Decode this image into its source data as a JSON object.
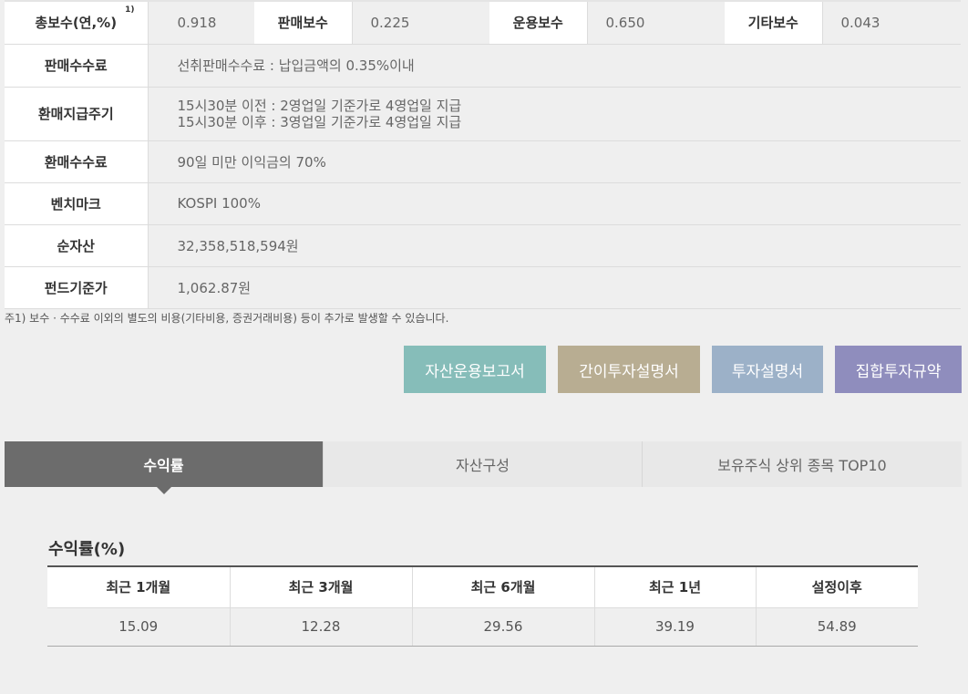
{
  "fees": {
    "total_label": "총보수(연,%)",
    "total_note": "1)",
    "total_value": "0.918",
    "sales_label": "판매보수",
    "sales_value": "0.225",
    "mgmt_label": "운용보수",
    "mgmt_value": "0.650",
    "other_label": "기타보수",
    "other_value": "0.043"
  },
  "rows": {
    "sales_fee_label": "판매수수료",
    "sales_fee_value": "선취판매수수료 : 납입금액의 0.35%이내",
    "redemption_cycle_label": "환매지급주기",
    "redemption_cycle_line1": "15시30분 이전 : 2영업일 기준가로 4영업일 지급",
    "redemption_cycle_line2": "15시30분 이후 : 3영업일 기준가로 4영업일 지급",
    "redemption_fee_label": "환매수수료",
    "redemption_fee_value": "90일 미만 이익금의 70%",
    "benchmark_label": "벤치마크",
    "benchmark_value": "KOSPI 100%",
    "net_assets_label": "순자산",
    "net_assets_value": "32,358,518,594원",
    "nav_label": "펀드기준가",
    "nav_value": "1,062.87원"
  },
  "footnote": "주1) 보수 · 수수료 이외의 별도의 비용(기타비용, 증권거래비용) 등이 추가로 발생할 수 있습니다.",
  "buttons": {
    "report": "자산운용보고서",
    "simple_prospectus": "간이투자설명서",
    "prospectus": "투자설명서",
    "rules": "집합투자규약"
  },
  "tabs": {
    "returns": "수익률",
    "assets": "자산구성",
    "top10": "보유주식 상위 종목 TOP10"
  },
  "returns": {
    "title": "수익률(%)",
    "headers": [
      "최근 1개월",
      "최근 3개월",
      "최근 6개월",
      "최근 1년",
      "설정이후"
    ],
    "values": [
      "15.09",
      "12.28",
      "29.56",
      "39.19",
      "54.89"
    ]
  },
  "colors": {
    "btn_report": "#86bdb9",
    "btn_simple": "#b8ad92",
    "btn_prospectus": "#9cb1c8",
    "btn_rules": "#8f8dbd",
    "tab_active": "#6c6c6c"
  }
}
